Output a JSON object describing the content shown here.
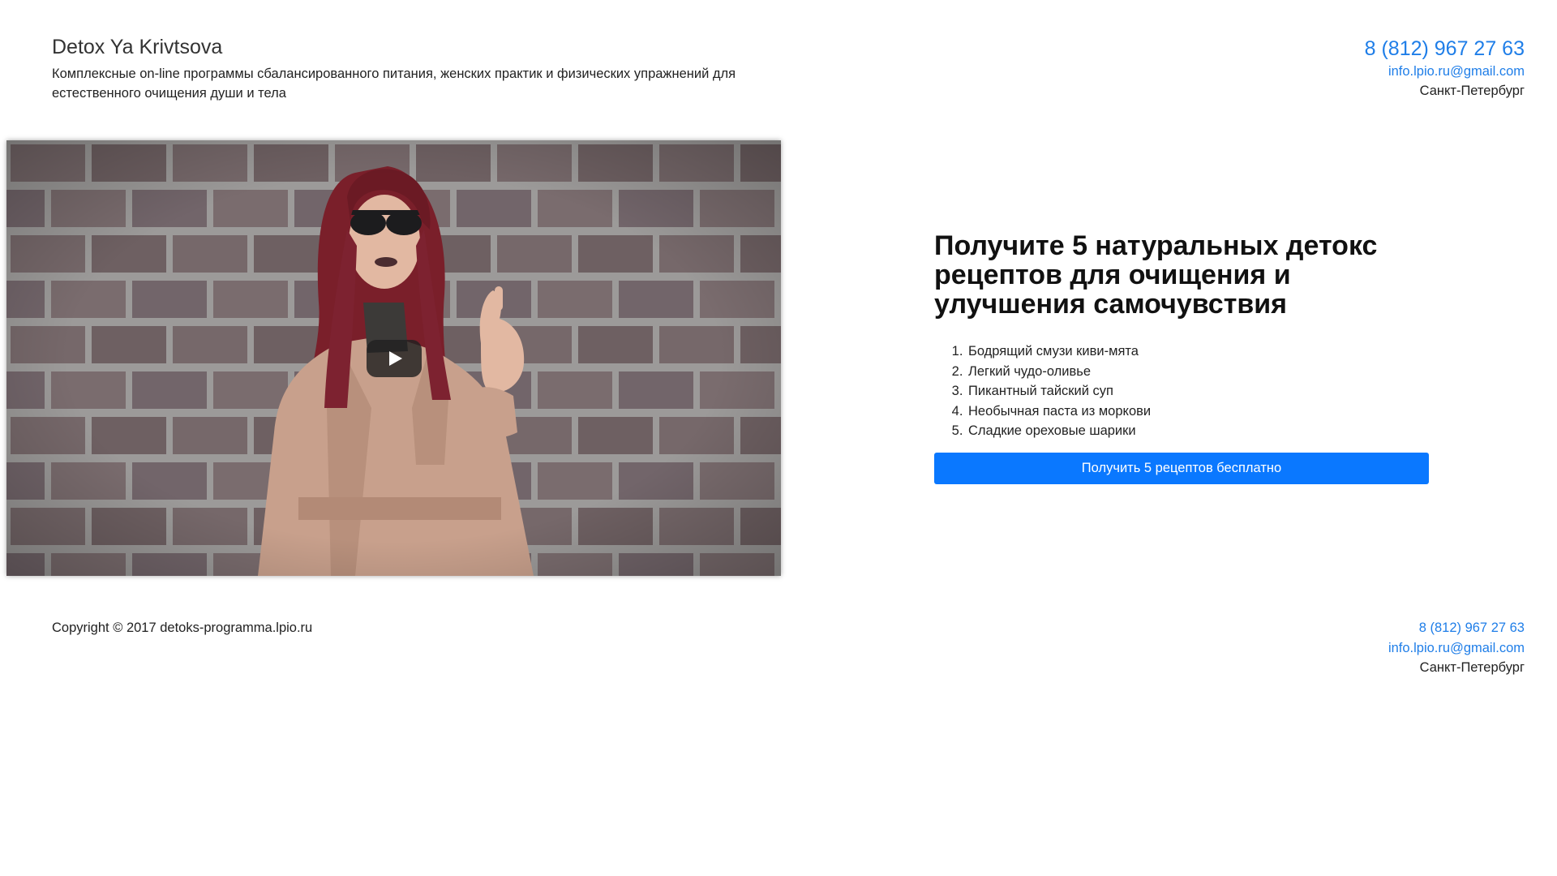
{
  "header": {
    "title": "Detox Ya Krivtsova",
    "tagline": "Комплексные on-line программы сбалансированного питания, женских практик и физических упражнений для естественного очищения души и тела",
    "phone": "8 (812) 967 27 63",
    "email": "info.lpio.ru@gmail.com",
    "city": "Санкт-Петербург"
  },
  "video": {
    "play_icon": "play-icon"
  },
  "offer": {
    "title": "Получите 5 натуральных детокс рецептов для очищения и улучшения самочувствия",
    "recipes": [
      "Бодрящий смузи киви-мята",
      "Легкий чудо-оливье",
      "Пикантный тайский суп",
      "Необычная паста из моркови",
      "Сладкие ореховые шарики"
    ],
    "cta_label": "Получить 5 рецептов бесплатно"
  },
  "footer": {
    "copyright": "Copyright © 2017 detoks-programma.lpio.ru",
    "phone": "8 (812) 967 27 63",
    "email": "info.lpio.ru@gmail.com",
    "city": "Санкт-Петербург"
  },
  "colors": {
    "accent": "#0a78ff",
    "link": "#1f7ee8",
    "text": "#222222"
  }
}
